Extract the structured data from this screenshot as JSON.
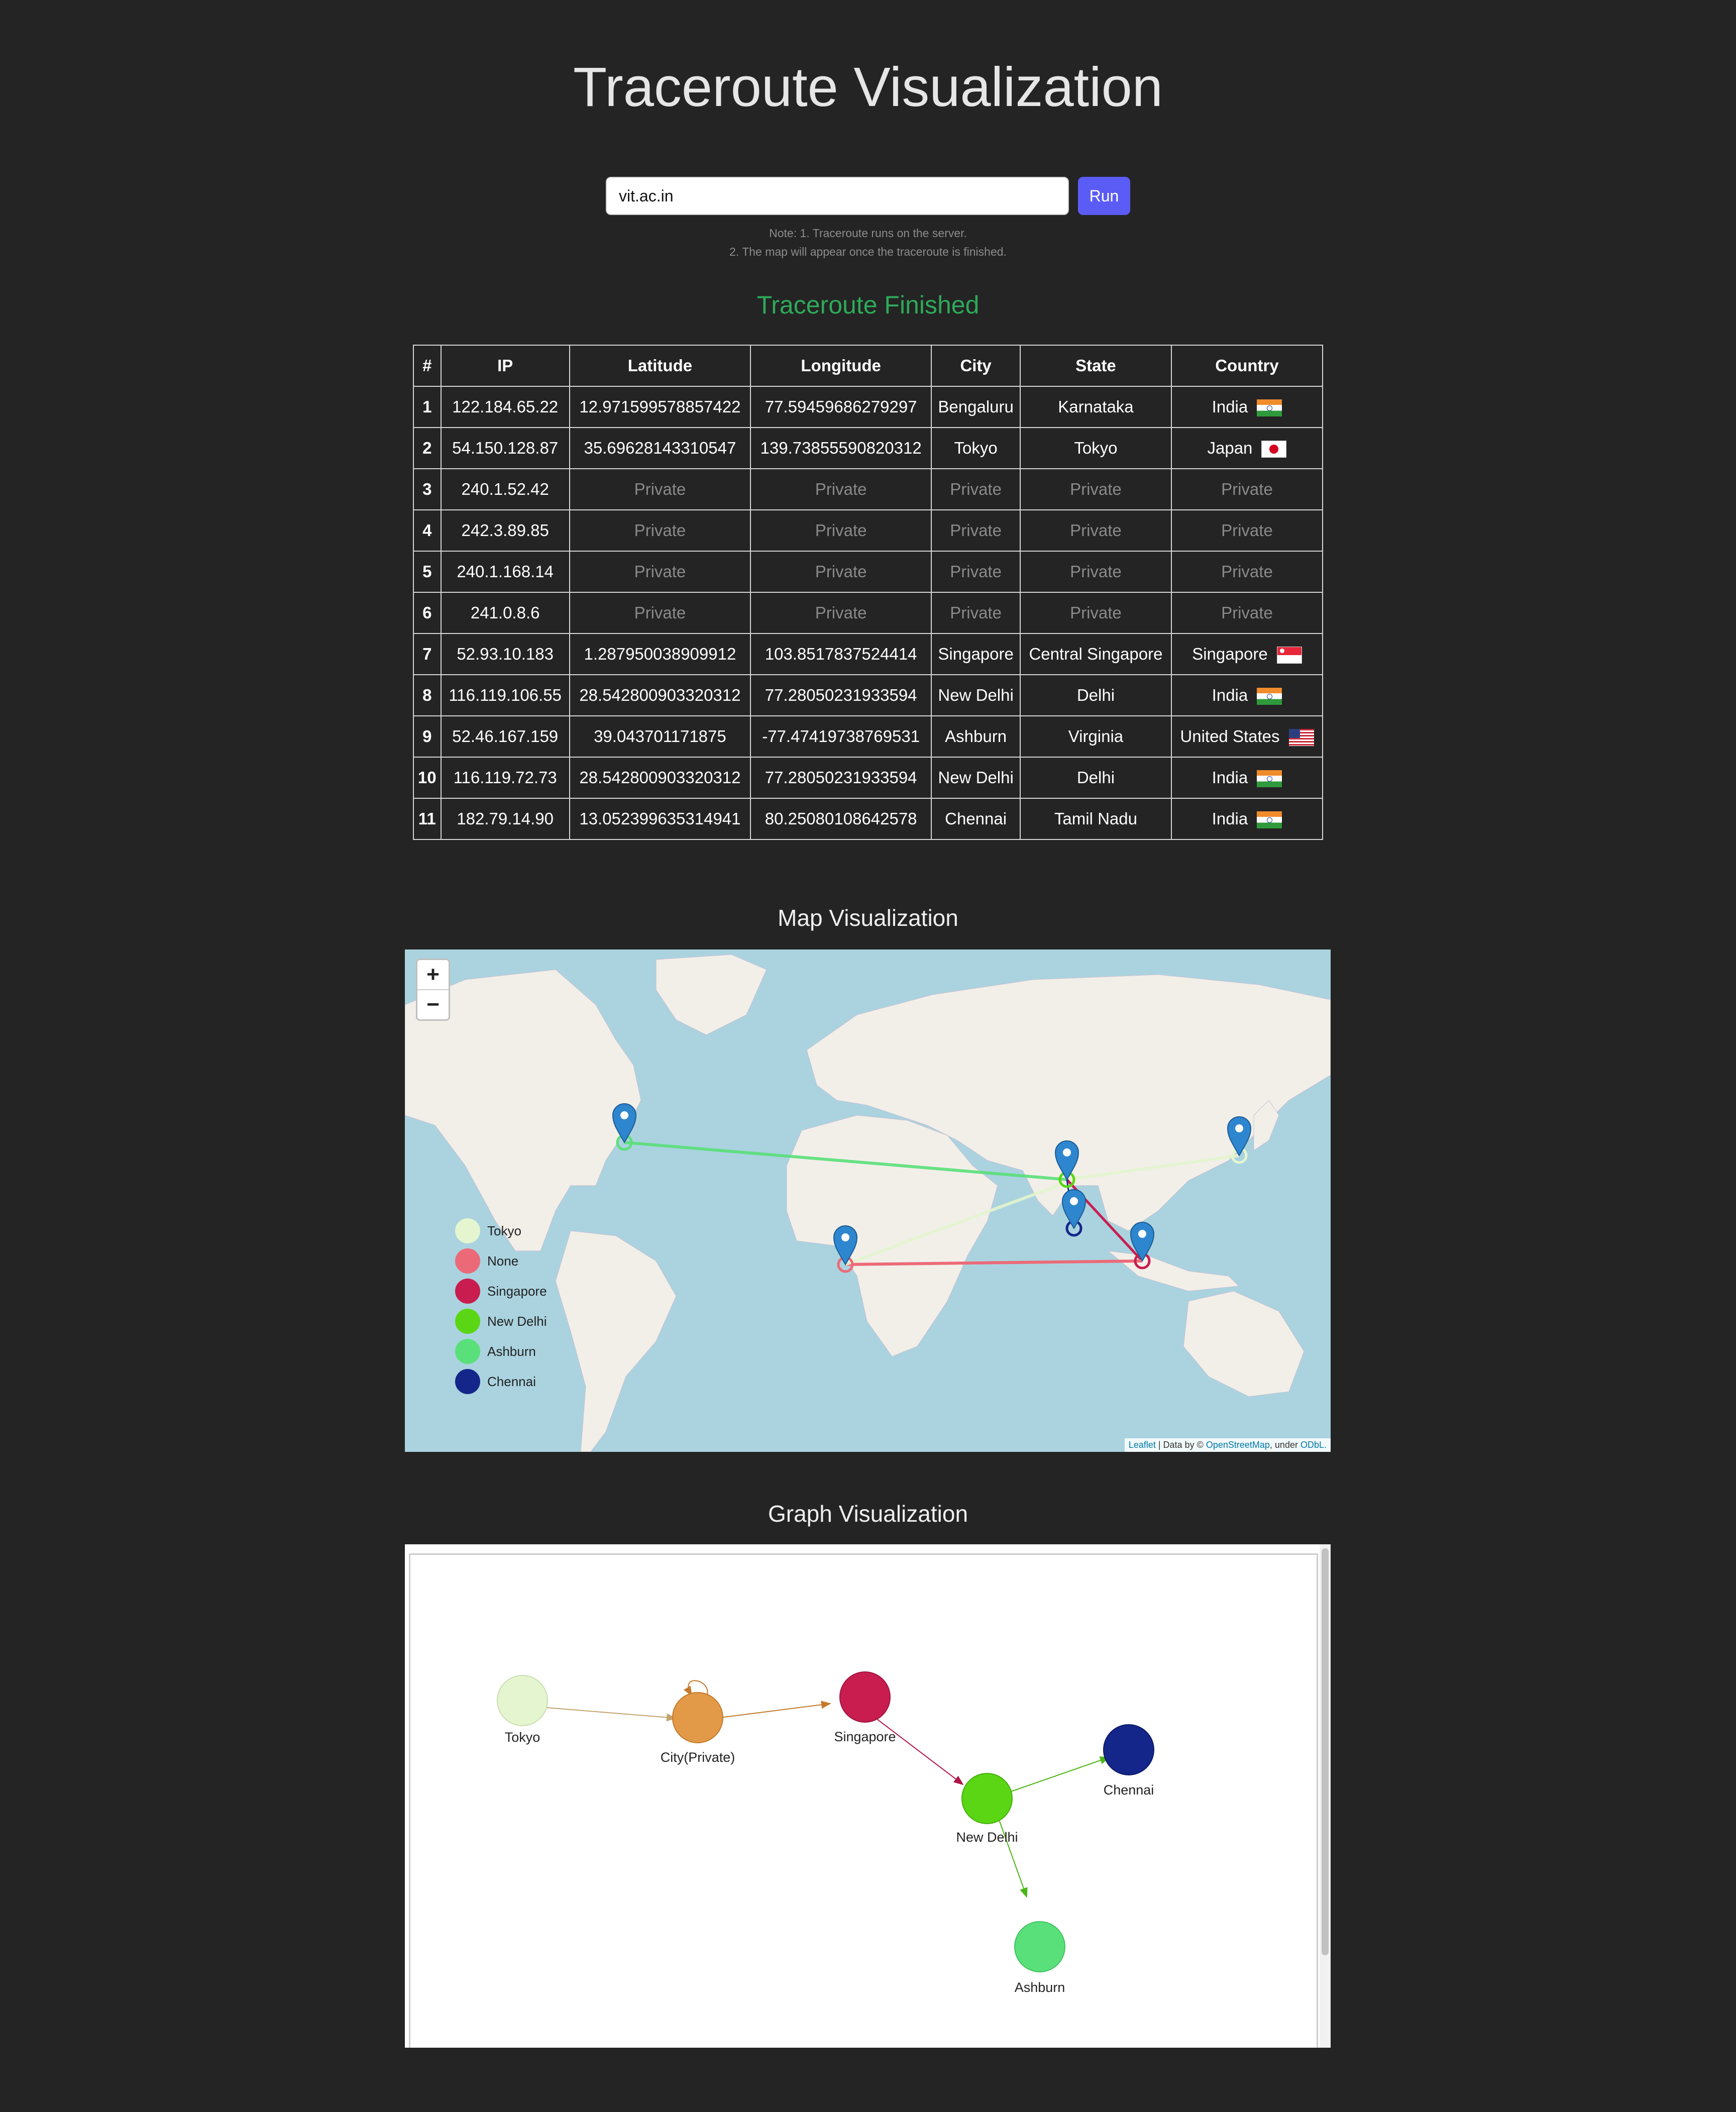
{
  "page": {
    "title": "Traceroute Visualization"
  },
  "search": {
    "value": "vit.ac.in",
    "run_label": "Run"
  },
  "notes": {
    "line1": "Note: 1. Traceroute runs on the server.",
    "line2": "2. The map will appear once the traceroute is finished."
  },
  "status": {
    "text": "Traceroute Finished",
    "color": "#2eaa5a"
  },
  "table": {
    "headers": [
      "#",
      "IP",
      "Latitude",
      "Longitude",
      "City",
      "State",
      "Country"
    ],
    "rows": [
      {
        "num": "1",
        "ip": "122.184.65.22",
        "lat": "12.971599578857422",
        "lon": "77.59459686279297",
        "city": "Bengaluru",
        "state": "Karnataka",
        "country": "India",
        "flag": "india-flag-icon"
      },
      {
        "num": "2",
        "ip": "54.150.128.87",
        "lat": "35.69628143310547",
        "lon": "139.73855590820312",
        "city": "Tokyo",
        "state": "Tokyo",
        "country": "Japan",
        "flag": "japan-flag-icon"
      },
      {
        "num": "3",
        "ip": "240.1.52.42",
        "lat": "Private",
        "lon": "Private",
        "city": "Private",
        "state": "Private",
        "country": "Private",
        "flag": ""
      },
      {
        "num": "4",
        "ip": "242.3.89.85",
        "lat": "Private",
        "lon": "Private",
        "city": "Private",
        "state": "Private",
        "country": "Private",
        "flag": ""
      },
      {
        "num": "5",
        "ip": "240.1.168.14",
        "lat": "Private",
        "lon": "Private",
        "city": "Private",
        "state": "Private",
        "country": "Private",
        "flag": ""
      },
      {
        "num": "6",
        "ip": "241.0.8.6",
        "lat": "Private",
        "lon": "Private",
        "city": "Private",
        "state": "Private",
        "country": "Private",
        "flag": ""
      },
      {
        "num": "7",
        "ip": "52.93.10.183",
        "lat": "1.287950038909912",
        "lon": "103.8517837524414",
        "city": "Singapore",
        "state": "Central Singapore",
        "country": "Singapore",
        "flag": "singapore-flag-icon"
      },
      {
        "num": "8",
        "ip": "116.119.106.55",
        "lat": "28.542800903320312",
        "lon": "77.28050231933594",
        "city": "New Delhi",
        "state": "Delhi",
        "country": "India",
        "flag": "india-flag-icon"
      },
      {
        "num": "9",
        "ip": "52.46.167.159",
        "lat": "39.043701171875",
        "lon": "-77.47419738769531",
        "city": "Ashburn",
        "state": "Virginia",
        "country": "United States",
        "flag": "us-flag-icon"
      },
      {
        "num": "10",
        "ip": "116.119.72.73",
        "lat": "28.542800903320312",
        "lon": "77.28050231933594",
        "city": "New Delhi",
        "state": "Delhi",
        "country": "India",
        "flag": "india-flag-icon"
      },
      {
        "num": "11",
        "ip": "182.79.14.90",
        "lat": "13.052399635314941",
        "lon": "80.25080108642578",
        "city": "Chennai",
        "state": "Tamil Nadu",
        "country": "India",
        "flag": "india-flag-icon"
      }
    ]
  },
  "map": {
    "title": "Map Visualization",
    "zoom_in": "+",
    "zoom_out": "−",
    "legend": [
      {
        "label": "Tokyo",
        "color": "#e4f5cf"
      },
      {
        "label": "None",
        "color": "#ec6a78"
      },
      {
        "label": "Singapore",
        "color": "#c91d4f"
      },
      {
        "label": "New Delhi",
        "color": "#5ad615"
      },
      {
        "label": "Ashburn",
        "color": "#5ae07a"
      },
      {
        "label": "Chennai",
        "color": "#142689"
      }
    ],
    "attribution": {
      "leaflet": "Leaflet",
      "sep": " | Data by © ",
      "osm": "OpenStreetMap",
      "under": ", under ",
      "odbl": "ODbL."
    }
  },
  "graph": {
    "title": "Graph Visualization",
    "nodes": [
      {
        "label": "Tokyo",
        "color": "#e4f5cf"
      },
      {
        "label": "City(Private)",
        "color": "#e39a48"
      },
      {
        "label": "Singapore",
        "color": "#c91d4f"
      },
      {
        "label": "New Delhi",
        "color": "#5ad615"
      },
      {
        "label": "Chennai",
        "color": "#142689"
      },
      {
        "label": "Ashburn",
        "color": "#5ae07a"
      }
    ]
  }
}
